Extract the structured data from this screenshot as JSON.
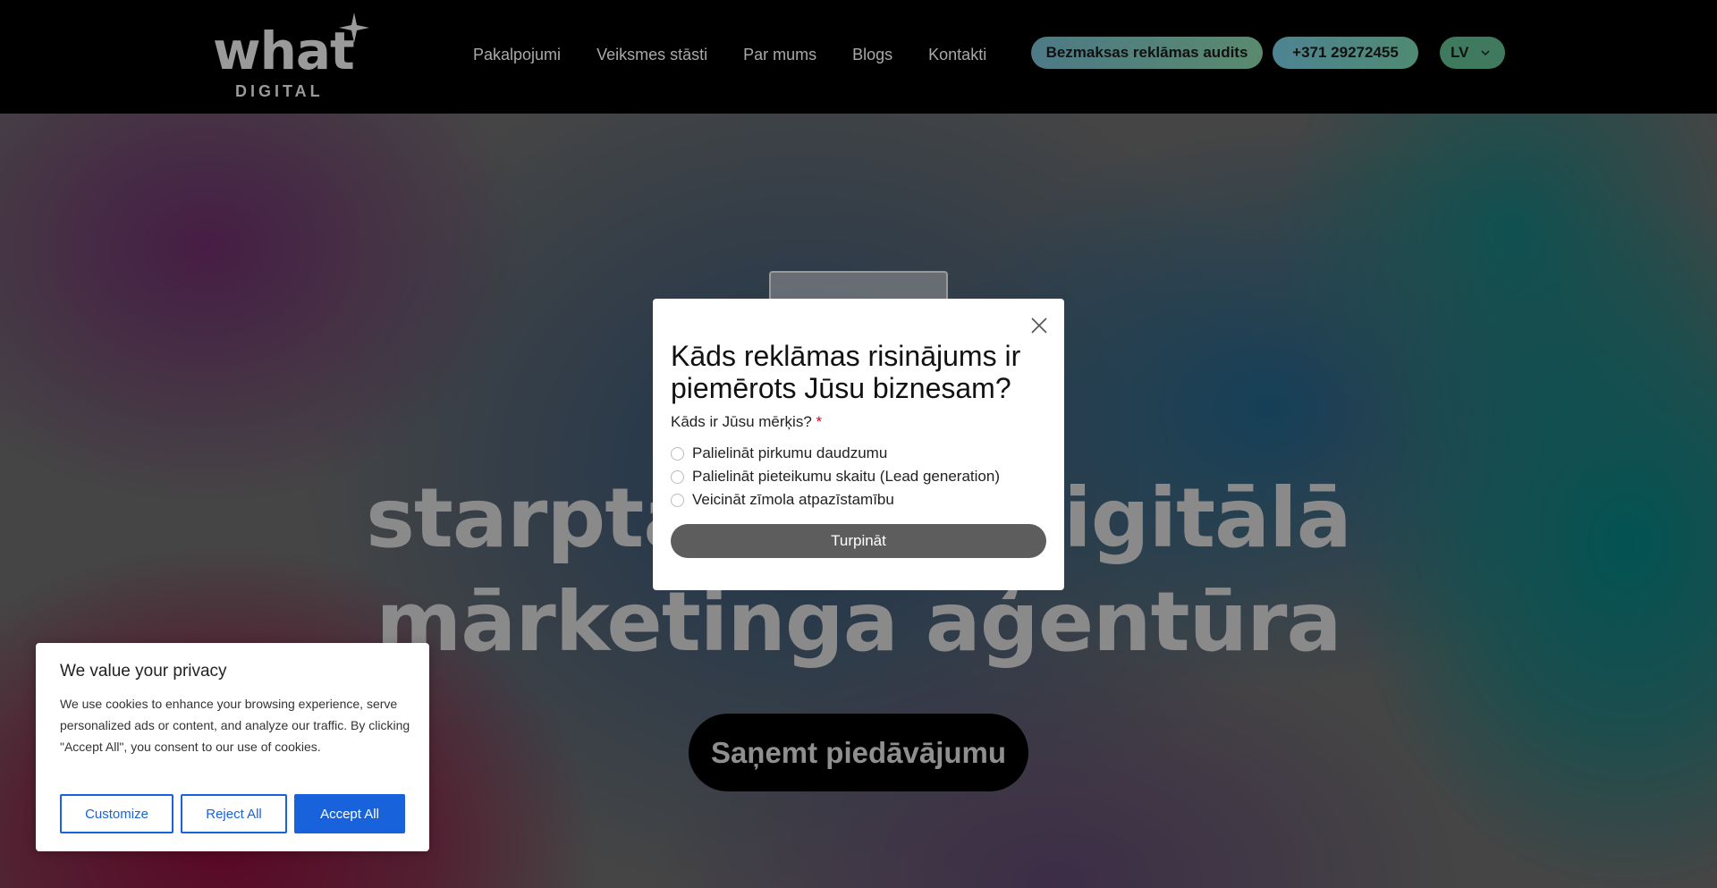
{
  "header": {
    "logo": {
      "word": "what",
      "sub": "DIGITAL"
    },
    "nav": [
      "Pakalpojumi",
      "Veiksmes stāsti",
      "Par mums",
      "Blogs",
      "Kontakti"
    ],
    "audit_button": "Bezmaksas reklāmas audits",
    "phone_button": "+371 29272455",
    "language": "LV"
  },
  "hero": {
    "title_line1": "starptautiska digitālā",
    "title_line2": "mārketinga aģentūra",
    "cta": "Saņemt piedāvājumu"
  },
  "modal": {
    "title": "Kāds reklāmas risinājums ir piemērots Jūsu biznesam?",
    "question": "Kāds ir Jūsu mērķis?",
    "required_mark": "*",
    "options": [
      "Palielināt pirkumu daudzumu",
      "Palielināt pieteikumu skaitu (Lead generation)",
      "Veicināt zīmola atpazīstamību"
    ],
    "submit": "Turpināt"
  },
  "cookie": {
    "title": "We value your privacy",
    "text": "We use cookies to enhance your browsing experience, serve personalized ads or content, and analyze our traffic. By clicking \"Accept All\", you consent to our use of cookies.",
    "customize": "Customize",
    "reject": "Reject All",
    "accept": "Accept All"
  },
  "colors": {
    "accent_blue": "#1863dc",
    "modal_button": "#5d5d5d",
    "required": "#d0021b"
  }
}
